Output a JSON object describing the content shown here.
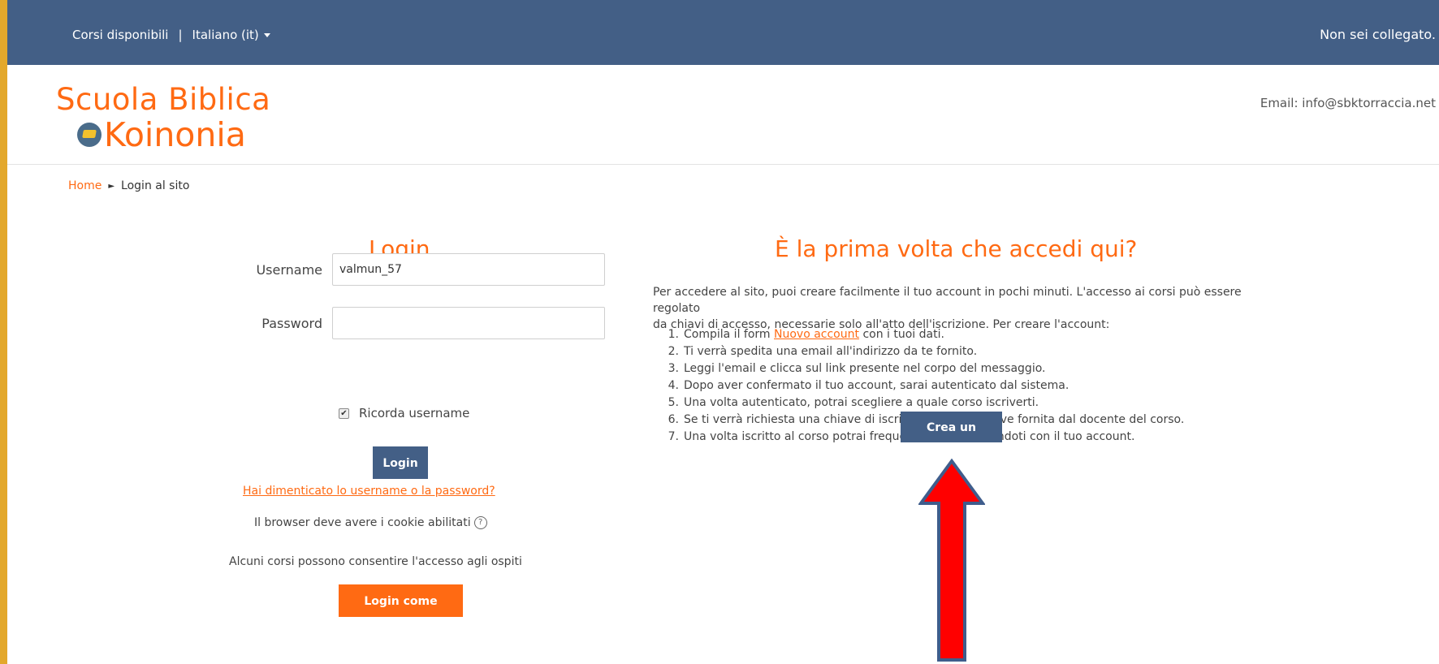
{
  "navbar": {
    "courses_link": "Corsi disponibili",
    "separator": "|",
    "language_label": "Italiano (it)",
    "login_status": "Non sei collegato."
  },
  "header": {
    "logo_line1": "Scuola Biblica",
    "logo_line2": "Koinonia",
    "email_text": "Email: info@sbktorraccia.net"
  },
  "breadcrumb": {
    "home": "Home",
    "current": "Login al sito"
  },
  "login": {
    "title": "Login",
    "username_label": "Username",
    "username_value": "valmun_57",
    "password_label": "Password",
    "password_value": "",
    "remember_label": "Ricorda username",
    "remember_checked": true,
    "login_button": "Login",
    "forgot_link": "Hai dimenticato lo username o la password?",
    "cookies_text": "Il browser deve avere i cookie abilitati",
    "guests_text": "Alcuni corsi possono consentire l'accesso agli ospiti",
    "guest_button": "Login come ospite"
  },
  "signup": {
    "title": "È la prima volta che accedi qui?",
    "intro_line1": "Per accedere al sito, puoi creare facilmente il tuo account in pochi minuti. L'accesso ai corsi può essere regolato",
    "intro_line2": "da chiavi di accesso, necessarie solo all'atto dell'iscrizione. Per creare l'account:",
    "steps": [
      {
        "num": "1.",
        "before": "Compila il form ",
        "link": "Nuovo account",
        "after": " con i tuoi dati."
      },
      {
        "num": "2.",
        "text": "Ti verrà spedita una email all'indirizzo da te fornito."
      },
      {
        "num": "3.",
        "text": "Leggi l'email e clicca sul link presente nel corpo del messaggio."
      },
      {
        "num": "4.",
        "text": "Dopo aver confermato il tuo account, sarai autenticato dal sistema."
      },
      {
        "num": "5.",
        "text": "Una volta autenticato, potrai scegliere a quale corso iscriverti."
      },
      {
        "num": "6.",
        "text": "Se ti verrà richiesta una chiave di iscrizione, usa la chiave fornita dal docente del corso."
      },
      {
        "num": "7.",
        "text": "Una volta iscritto al corso potrai frequentarlo autenticandoti con il tuo account."
      }
    ],
    "create_button": "Crea un account"
  },
  "colors": {
    "navbar": "#435f86",
    "accent": "#ff6a13",
    "arrow": "#ff0000",
    "arrow_outline": "#3f5d8c"
  },
  "icons": [
    "globe-graduation-cap-icon",
    "caret-down-icon",
    "help-icon",
    "checkbox-checked-icon",
    "up-arrow-annotation-icon"
  ]
}
